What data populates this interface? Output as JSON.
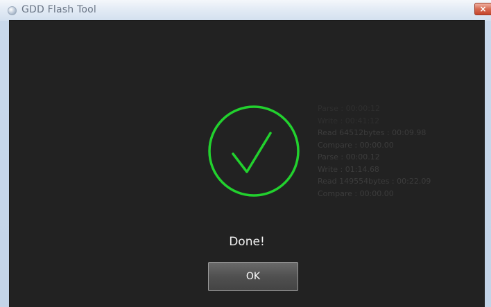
{
  "window": {
    "title": "GDD Flash Tool",
    "close_label": "×"
  },
  "icons": {
    "app": "app-icon",
    "close": "close-icon",
    "success": "checkmark-circle-icon"
  },
  "colors": {
    "accent_green": "#22d12e",
    "background": "#222222",
    "log_text": "#3c3c3c"
  },
  "log": {
    "lines": [
      "Parse : 00:00:12",
      "Write : 00:41:12",
      "Read 64512bytes : 00:09.98",
      "Compare : 00:00.00",
      "Parse : 00:00.12",
      "Write : 01:14.68",
      "Read 149554bytes : 00:22.09",
      "Compare : 00:00.00"
    ]
  },
  "status": {
    "message": "Done!"
  },
  "actions": {
    "ok_label": "OK"
  }
}
